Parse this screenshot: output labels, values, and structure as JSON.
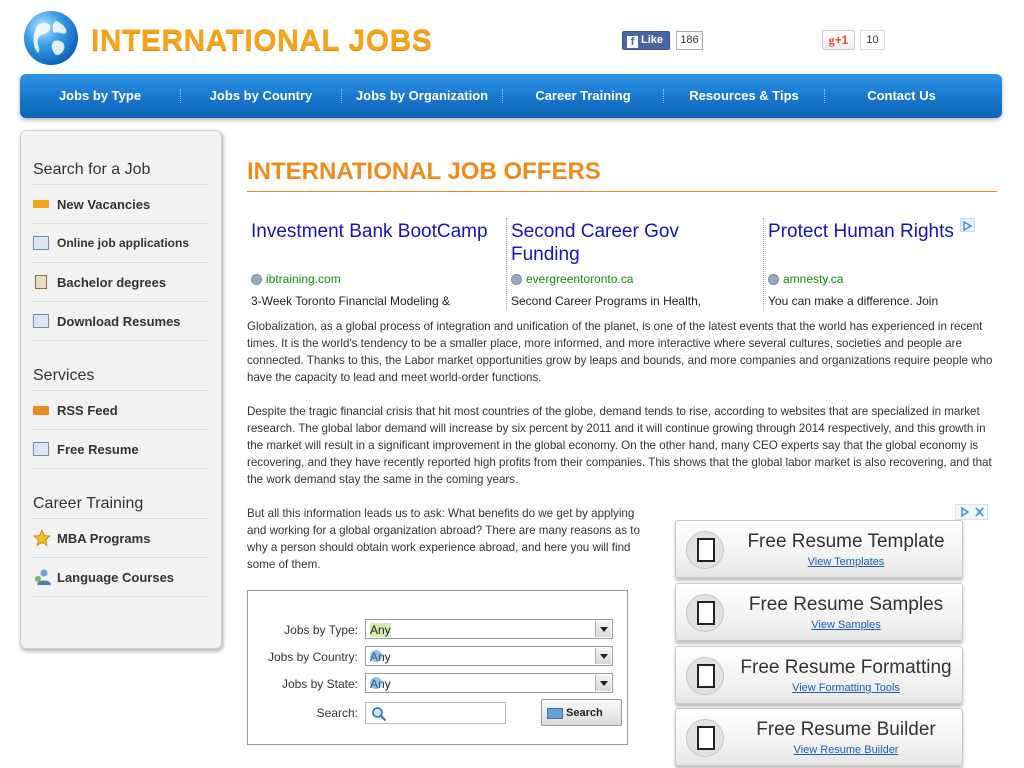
{
  "header": {
    "site_title": "INTERNATIONAL JOBS",
    "fb_like_label": "Like",
    "fb_like_count": "186",
    "gplus_label": "+1",
    "gplus_count": "10"
  },
  "nav": {
    "items": [
      {
        "label": "Jobs by Type"
      },
      {
        "label": "Jobs by Country"
      },
      {
        "label": "Jobs by Organization"
      },
      {
        "label": "Career Training"
      },
      {
        "label": "Resources & Tips"
      },
      {
        "label": "Contact Us"
      }
    ]
  },
  "sidebar": {
    "sections": [
      {
        "heading": "Search for a Job",
        "items": [
          {
            "label": "New Vacancies",
            "icon": "new-badge-icon"
          },
          {
            "label": "Online job applications",
            "icon": "id-card-icon"
          },
          {
            "label": "Bachelor degrees",
            "icon": "book-icon"
          },
          {
            "label": "Download Resumes",
            "icon": "id-card-icon"
          }
        ]
      },
      {
        "heading": "Services",
        "items": [
          {
            "label": "RSS Feed",
            "icon": "rss-icon"
          },
          {
            "label": "Free Resume",
            "icon": "id-card-icon"
          }
        ]
      },
      {
        "heading": "Career Training",
        "items": [
          {
            "label": "MBA Programs",
            "icon": "star-icon"
          },
          {
            "label": "Language Courses",
            "icon": "person-icon"
          }
        ]
      }
    ]
  },
  "main": {
    "heading": "INTERNATIONAL JOB OFFERS",
    "ads": [
      {
        "title": "Investment Bank BootCamp",
        "url": "ibtraining.com",
        "desc": "3-Week Toronto Financial Modeling &"
      },
      {
        "title": "Second Career Gov Funding",
        "url": "evergreentoronto.ca",
        "desc": "Second Career Programs in Health,"
      },
      {
        "title": "Protect Human Rights",
        "url": "amnesty.ca",
        "desc": "You can make a difference. Join"
      }
    ],
    "paragraphs": [
      "Globalization, as a global process of integration and unification of the planet, is one of the latest events that the world has experienced in recent times. It is the world's tendency to be a smaller place, more informed, and more interactive where several cultures, societies and people are connected. Thanks to this, the Labor market opportunities grow by leaps and bounds, and more companies and organizations require people who have the capacity to lead and meet world-order functions.",
      "Despite the tragic financial crisis that hit most countries of the globe, demand tends to rise, according to websites that are specialized in market research. The global labor demand will increase by six percent by 2011 and it will continue growing through 2014 respectively, and this growth in the market will result in a significant improvement in the global economy. On the other hand, many CEO experts say that the global economy is recovering, and they have recently reported high profits from their companies. This shows that the global labor market is also recovering, and that the work demand stay the same in the coming years.",
      "But all this information leads us to ask: What benefits do we get by applying and working for a global organization abroad? There are many reasons as to why a person should obtain work experience abroad, and here you will find some of them."
    ]
  },
  "search_form": {
    "type_label": "Jobs by Type:",
    "type_value": "Any",
    "country_label": "Jobs by Country:",
    "country_value": "Any",
    "state_label": "Jobs by State:",
    "state_value": "Any",
    "search_label": "Search:",
    "search_value": "",
    "button_label": "Search"
  },
  "right_ads": [
    {
      "title": "Free Resume Template",
      "link": "View Templates"
    },
    {
      "title": "Free Resume Samples",
      "link": "View Samples"
    },
    {
      "title": "Free Resume Formatting",
      "link": "View Formatting Tools"
    },
    {
      "title": "Free Resume Builder",
      "link": "View Resume Builder"
    }
  ],
  "colors": {
    "accent_orange": "#f08a1c",
    "nav_blue": "#1878cf",
    "ad_link_blue": "#1414b8",
    "ad_url_green": "#168a16"
  }
}
